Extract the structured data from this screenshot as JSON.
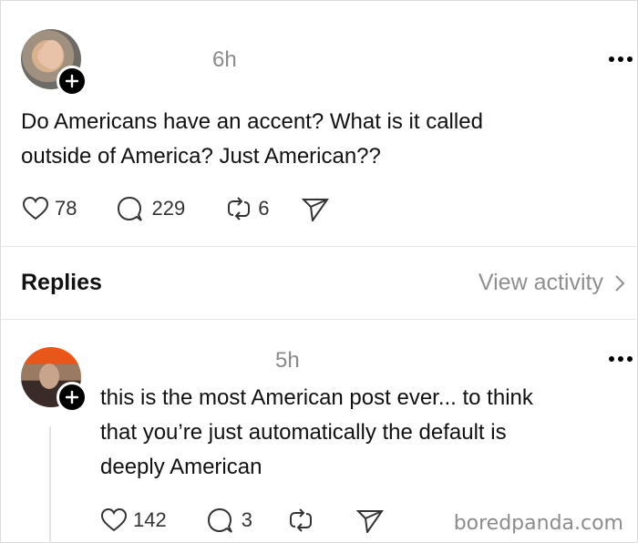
{
  "post": {
    "time": "6h",
    "text_line1": "Do Americans have an accent? What is it called",
    "text_line2": "outside of America? Just American??",
    "likes": "78",
    "comments": "229",
    "reposts": "6",
    "icons": [
      "heart-icon",
      "comment-icon",
      "repost-icon",
      "share-icon",
      "more-icon",
      "follow-plus-icon"
    ]
  },
  "replies_bar": {
    "label": "Replies",
    "view_activity": "View activity"
  },
  "reply": {
    "time": "5h",
    "text_line1": "this is the most American post ever... to think",
    "text_line2": "that you’re just automatically the default is",
    "text_line3": "deeply American",
    "likes": "142",
    "comments": "3"
  },
  "watermark": "boredpanda.com"
}
